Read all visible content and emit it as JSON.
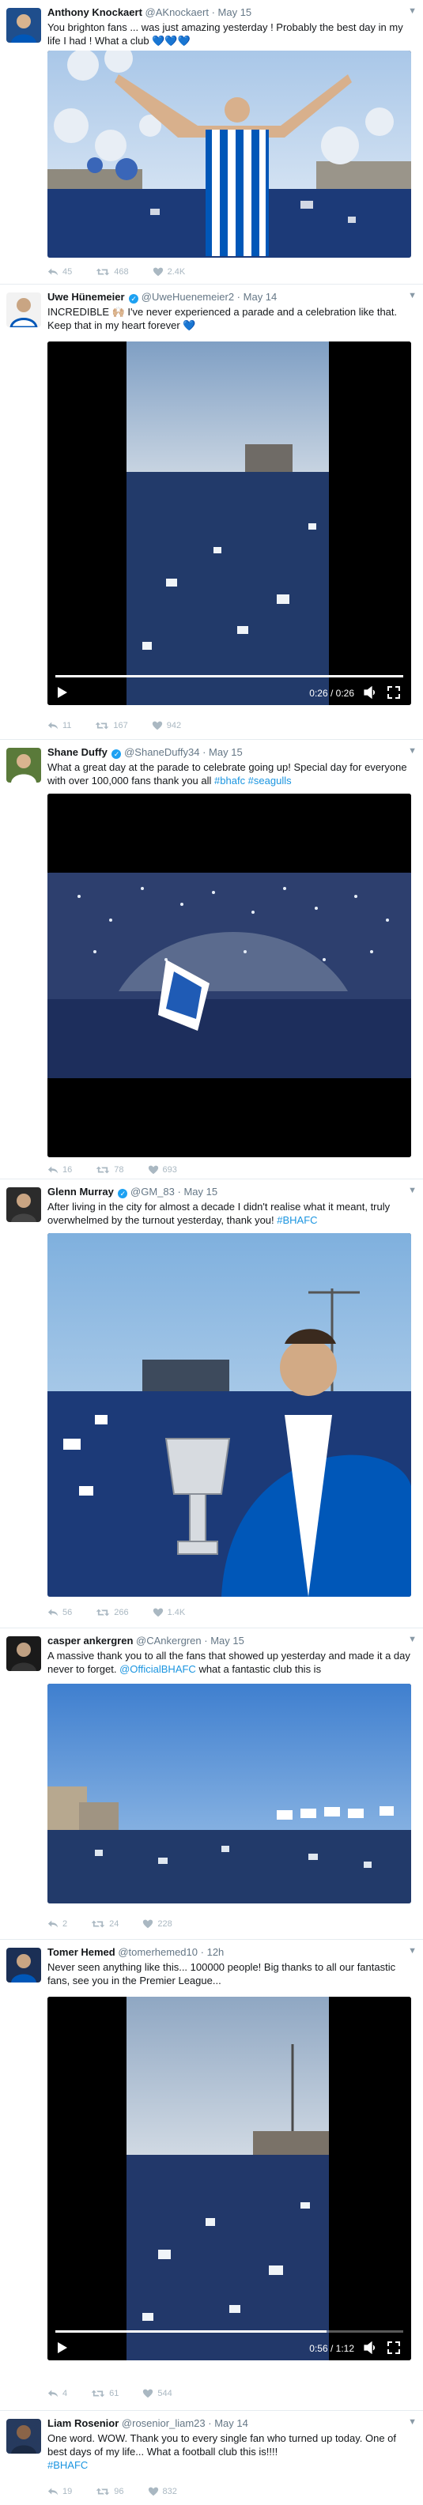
{
  "colors": {
    "link": "#1b95e0",
    "verified": "#1da1f2",
    "muted": "#657786",
    "action_icons": "#aab8c2",
    "brighton_blue": "#0057b8"
  },
  "icons": {
    "reply": "reply-icon",
    "retweet": "retweet-icon",
    "like": "heart-icon",
    "more": "chevron-down-icon",
    "play": "play-icon",
    "volume": "volume-icon",
    "fullscreen": "fullscreen-icon"
  },
  "tweets": [
    {
      "name": "Anthony Knockaert",
      "handle": "@AKnockaert",
      "sep": "·",
      "time": "May 15",
      "text": "You brighton fans ... was just amazing yesterday ! Probably the best day in my life I had ! What a club",
      "emoji": "💙💙💙",
      "replies": "45",
      "retweets": "468",
      "likes": "2.4K"
    },
    {
      "name": "Uwe Hünemeier",
      "handle": "@UweHuenemeier2",
      "sep": "·",
      "time": "May 14",
      "text": "INCREDIBLE 🙌🏼 I've never experienced a parade and a celebration like that. Keep that in my heart forever",
      "emoji": "💙",
      "video_time": "0:26 / 0:26",
      "video_progress": 1.0,
      "replies": "11",
      "retweets": "167",
      "likes": "942"
    },
    {
      "name": "Shane Duffy",
      "handle": "@ShaneDuffy34",
      "sep": "·",
      "time": "May 15",
      "text_before": "What a great day at the parade to celebrate going up! Special day for everyone with over 100,000 fans thank you all ",
      "hashtags": "#bhafc #seagulls",
      "replies": "16",
      "retweets": "78",
      "likes": "693"
    },
    {
      "name": "Glenn Murray",
      "handle": "@GM_83",
      "sep": "·",
      "time": "May 15",
      "text_before": "After living in the city for almost a decade I didn't realise what it meant, truly overwhelmed by the turnout yesterday, thank you! ",
      "hashtags": "#BHAFC",
      "replies": "56",
      "retweets": "266",
      "likes": "1.4K"
    },
    {
      "name": "casper ankergren",
      "handle": "@CAnkergren",
      "sep": "·",
      "time": "May 15",
      "text_before": "A massive thank you to all the fans that showed up yesterday and made it a day never to forget. ",
      "mention": "@OfficialBHAFC",
      "text_after": " what a fantastic club this is",
      "replies": "2",
      "retweets": "24",
      "likes": "228"
    },
    {
      "name": "Tomer Hemed",
      "handle": "@tomerhemed10",
      "sep": "·",
      "time": "12h",
      "text": "Never seen anything like this... 100000 people! Big thanks to all our fantastic fans, see you in the Premier League...",
      "video_time": "0:56 / 1:12",
      "video_progress": 0.78,
      "replies": "4",
      "retweets": "61",
      "likes": "544"
    },
    {
      "name": "Liam Rosenior",
      "handle": "@rosenior_liam23",
      "sep": "·",
      "time": "May 14",
      "text": "One word. WOW. Thank you to every single fan who turned up today. One of best days of my life... What a football club this is!!!!",
      "hashtags": "#BHAFC",
      "replies": "19",
      "retweets": "96",
      "likes": "832"
    }
  ]
}
